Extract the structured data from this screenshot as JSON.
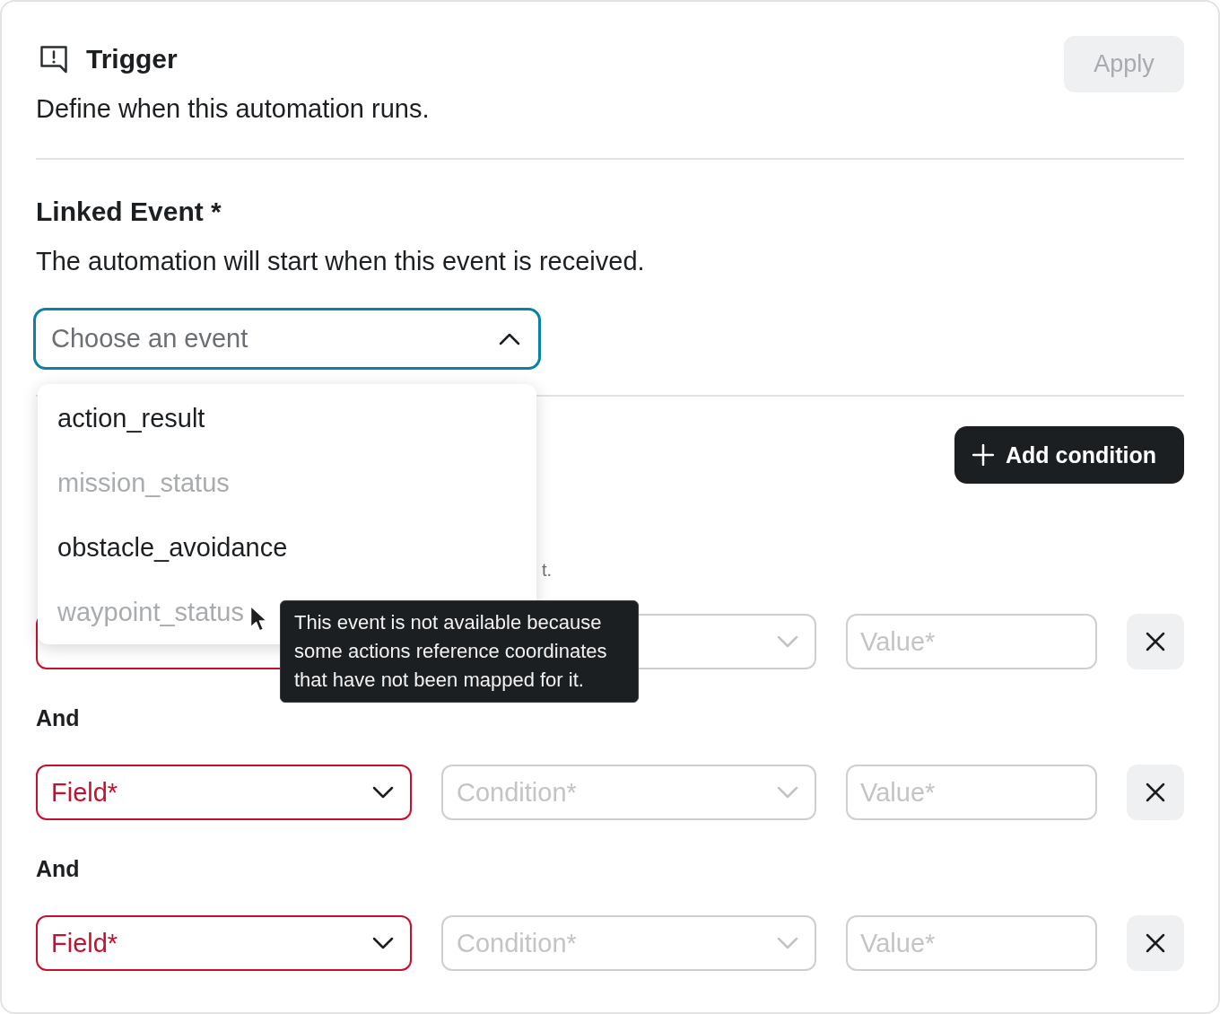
{
  "header": {
    "title": "Trigger",
    "subtitle": "Define when this automation runs.",
    "apply_button": {
      "label": "Apply",
      "disabled": true
    }
  },
  "linked_event": {
    "label": "Linked Event *",
    "description": "The automation will start when this event is received.",
    "select": {
      "placeholder": "Choose an event",
      "expanded": true
    },
    "options": [
      {
        "label": "action_result",
        "disabled": false
      },
      {
        "label": "mission_status",
        "disabled": true
      },
      {
        "label": "obstacle_avoidance",
        "disabled": false
      },
      {
        "label": "waypoint_status",
        "disabled": true
      }
    ]
  },
  "tooltip": {
    "lines": [
      "This event is not available because",
      "some actions reference coordinates",
      "that have not been mapped for it."
    ]
  },
  "conditions": {
    "add_button": {
      "label": "Add condition"
    },
    "description_fragment": "t.",
    "rows": [
      {
        "field": {
          "invalid": true
        },
        "condition": {
          "disabled": true
        },
        "value": {
          "placeholder": "Value*",
          "disabled": true
        }
      },
      {
        "connector": "And",
        "field": {
          "placeholder": "Field*",
          "invalid": true
        },
        "condition": {
          "placeholder": "Condition*",
          "disabled": true
        },
        "value": {
          "placeholder": "Value*",
          "disabled": true
        }
      },
      {
        "connector": "And",
        "field": {
          "placeholder": "Field*",
          "invalid": true
        },
        "condition": {
          "placeholder": "Condition*",
          "disabled": true
        },
        "value": {
          "placeholder": "Value*",
          "disabled": true
        }
      }
    ]
  }
}
